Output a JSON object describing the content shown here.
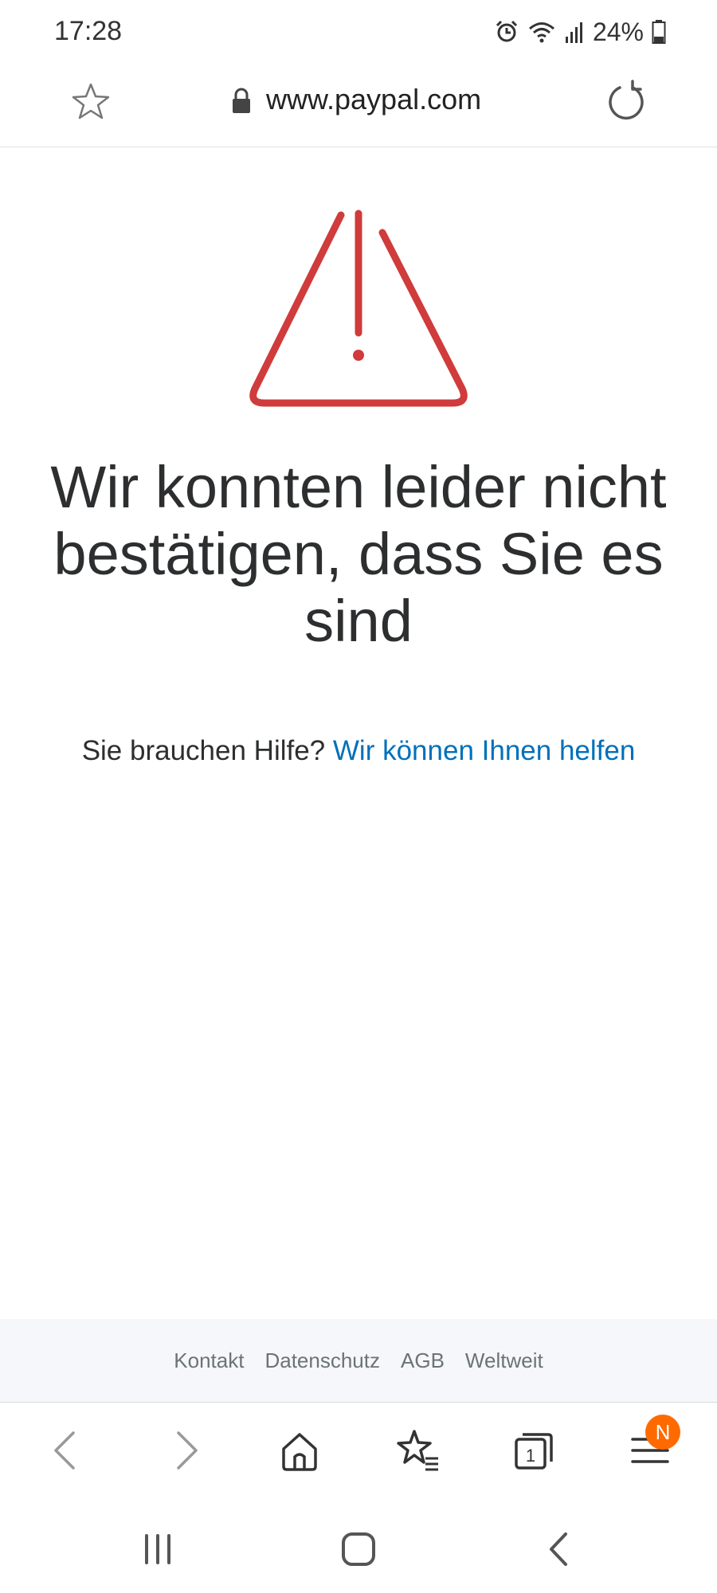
{
  "status": {
    "time": "17:28",
    "battery": "24%",
    "icons": [
      "alarm-icon",
      "wifi-icon",
      "signal-icon",
      "battery-icon"
    ]
  },
  "browser": {
    "url": "www.paypal.com",
    "icons": [
      "star-icon",
      "lock-icon",
      "reload-icon"
    ]
  },
  "content": {
    "title": "Wir konnten leider nicht bestätigen, dass Sie es sind",
    "help_prefix": "Sie brauchen Hilfe?",
    "help_link": "Wir können Ihnen helfen"
  },
  "footer": {
    "links": [
      "Kontakt",
      "Datenschutz",
      "AGB",
      "Weltweit"
    ]
  },
  "navbar": {
    "icons": [
      "back-arrow-icon",
      "forward-arrow-icon",
      "home-icon",
      "bookmarks-icon",
      "tabs-icon",
      "menu-icon"
    ],
    "tab_count": "1",
    "menu_badge": "N"
  },
  "colors": {
    "warning_red": "#d03b3b",
    "link_blue": "#0070ba",
    "badge_orange": "#ff6a00",
    "footer_bg": "#f5f7fa"
  }
}
